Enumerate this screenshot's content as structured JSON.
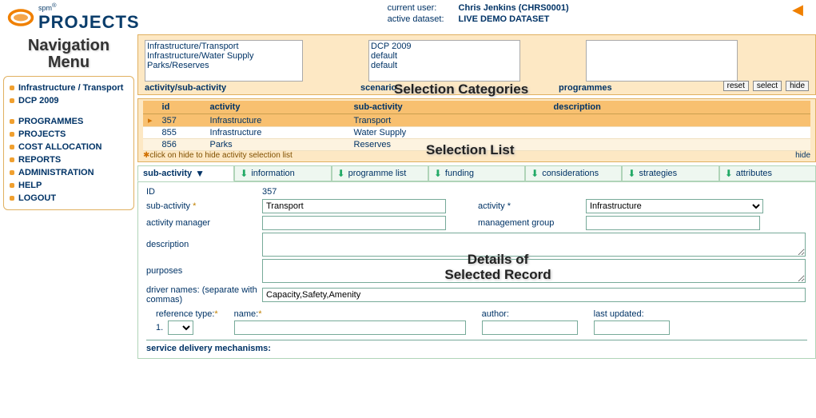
{
  "header": {
    "brand_spm": "spm",
    "brand_main": "PROJECTS",
    "user_label": "current user:",
    "user_value": "Chris Jenkins (CHRS0001)",
    "dataset_label": "active dataset:",
    "dataset_value": "LIVE DEMO DATASET"
  },
  "sidebar": {
    "title1": "Navigation",
    "title2": "Menu",
    "context": [
      "Infrastructure / Transport",
      "DCP 2009"
    ],
    "items": [
      "PROGRAMMES",
      "PROJECTS",
      "COST ALLOCATION",
      "REPORTS",
      "ADMINISTRATION",
      "HELP",
      "LOGOUT"
    ]
  },
  "selection": {
    "list_activity": [
      "Infrastructure/Transport",
      "Infrastructure/Water Supply",
      "Parks/Reserves"
    ],
    "list_scenario": [
      "DCP 2009",
      "default",
      "default"
    ],
    "label_activity": "activity/sub-activity",
    "label_scenario": "scenario",
    "label_programmes": "programmes",
    "btn_reset": "reset",
    "btn_select": "select",
    "btn_hide": "hide",
    "overlay": "Selection Categories"
  },
  "grid": {
    "cols": {
      "id": "id",
      "activity": "activity",
      "sub": "sub-activity",
      "desc": "description"
    },
    "rows": [
      {
        "id": "357",
        "activity": "Infrastructure",
        "sub": "Transport",
        "desc": ""
      },
      {
        "id": "855",
        "activity": "Infrastructure",
        "sub": "Water Supply",
        "desc": ""
      },
      {
        "id": "856",
        "activity": "Parks",
        "sub": "Reserves",
        "desc": ""
      }
    ],
    "note": "click on hide to hide activity selection list",
    "hide": "hide",
    "overlay": "Selection List"
  },
  "tabs": [
    "sub-activity",
    "information",
    "programme list",
    "funding",
    "considerations",
    "strategies",
    "attributes"
  ],
  "detail": {
    "id_label": "ID",
    "id_value": "357",
    "sub_label": "sub-activity",
    "sub_value": "Transport",
    "act_label": "activity",
    "act_value": "Infrastructure",
    "mgr_label": "activity manager",
    "mgr_value": "",
    "grp_label": "management group",
    "desc_label": "description",
    "purp_label": "purposes",
    "drv_label": "driver names: (separate with commas)",
    "drv_value": "Capacity,Safety,Amenity",
    "ref_type_label": "reference type:",
    "ref_idx": "1.",
    "name_label": "name:",
    "author_label": "author:",
    "updated_label": "last updated:",
    "svc_label": "service delivery mechanisms:",
    "overlay1": "Details of",
    "overlay2": "Selected Record"
  }
}
